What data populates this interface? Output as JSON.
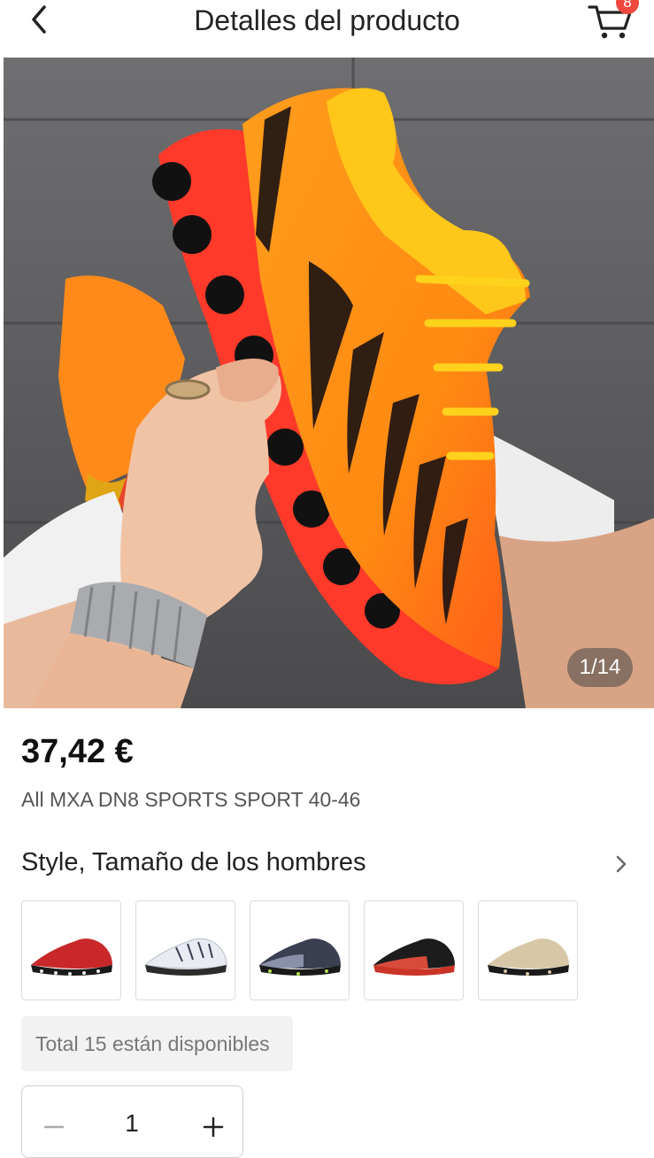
{
  "header": {
    "title": "Detalles del producto",
    "back_icon": "chevron-left-icon",
    "cart_icon": "cart-icon",
    "cart_badge": "8"
  },
  "gallery": {
    "counter": "1/14",
    "image_subject": "orange and red running shoe held in hand"
  },
  "product": {
    "price": "37,42 €",
    "name": "All MXA DN8 SPORTS SPORT 40-46"
  },
  "variant": {
    "title": "Style, Tamaño de los hombres",
    "chevron_icon": "chevron-right-icon",
    "options": [
      {
        "color": "#c8282a"
      },
      {
        "color": "#e8ecf2"
      },
      {
        "color": "#3a3f52"
      },
      {
        "color": "#1c1c1c"
      },
      {
        "color": "#d8c7a6"
      }
    ]
  },
  "availability": {
    "text": "Total 15 están disponibles"
  },
  "quantity": {
    "value": "1",
    "minus_icon": "minus-icon",
    "plus_icon": "plus-icon"
  },
  "colors": {
    "accent": "#f0483e",
    "text": "#222222",
    "muted": "#777777"
  }
}
